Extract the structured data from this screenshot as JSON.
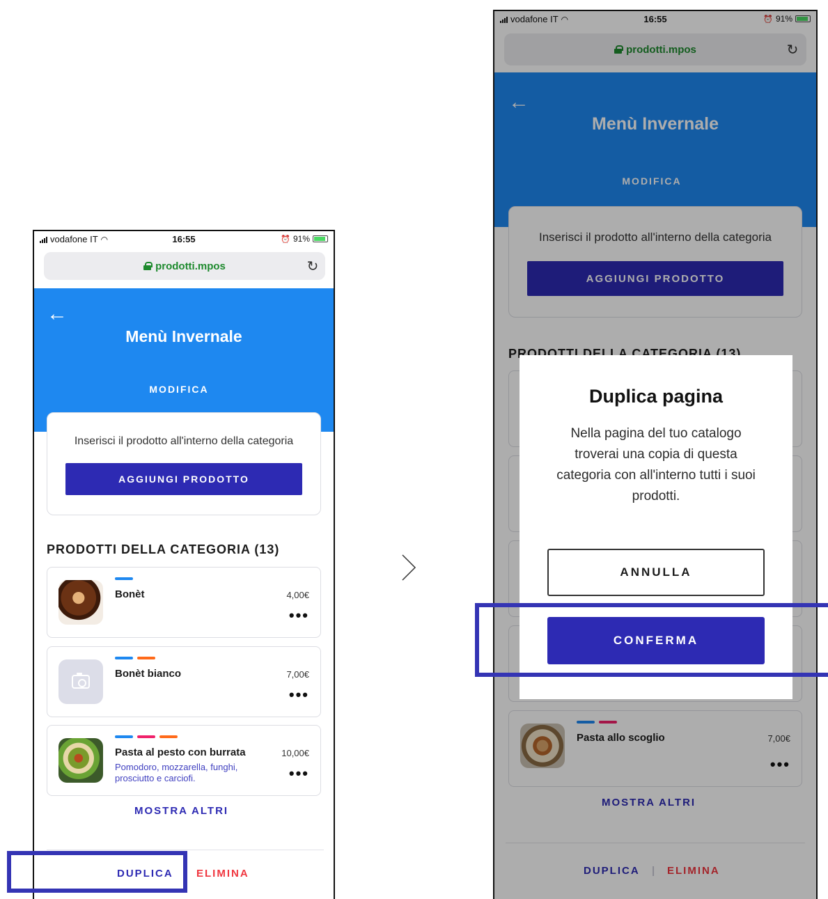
{
  "status_bar": {
    "carrier": "vodafone IT",
    "time": "16:55",
    "battery": "91%"
  },
  "browser": {
    "url": "prodotti.mpos"
  },
  "header": {
    "title": "Menù Invernale",
    "edit_label": "MODIFICA"
  },
  "add_card": {
    "hint": "Inserisci il prodotto all'interno della categoria",
    "button_label": "AGGIUNGI PRODOTTO"
  },
  "products_section": {
    "title": "PRODOTTI DELLA CATEGORIA (13)",
    "show_more_label": "MOSTRA ALTRI",
    "items": [
      {
        "name": "Bonèt",
        "price": "4,00€",
        "description": "",
        "tag_colors": [
          "#1e88f0"
        ],
        "thumb": "bonet-photo"
      },
      {
        "name": "Bonèt bianco",
        "price": "7,00€",
        "description": "",
        "tag_colors": [
          "#1e88f0",
          "#ff6a1a"
        ],
        "thumb": "camera-icon"
      },
      {
        "name": "Pasta al pesto con burrata",
        "price": "10,00€",
        "description": "Pomodoro, mozzarella, funghi, prosciutto e carciofi.",
        "tag_colors": [
          "#1e88f0",
          "#f0216a",
          "#ff6a1a"
        ],
        "thumb": "pasta-photo"
      },
      {
        "name": "Pasta allo scoglio",
        "price": "7,00€",
        "description": "",
        "tag_colors": [
          "#1e88f0",
          "#f0216a"
        ],
        "thumb": "scoglio-photo"
      }
    ]
  },
  "footer_actions": {
    "duplicate_label": "DUPLICA",
    "delete_label": "ELIMINA",
    "separator": "|"
  },
  "more_icon": "•••",
  "back_icon": "←",
  "reload_icon": "↻",
  "modal": {
    "title": "Duplica pagina",
    "body": "Nella pagina del tuo catalogo troverai una copia di questa categoria con all'interno tutti i suoi prodotti.",
    "cancel_label": "ANNULLA",
    "confirm_label": "CONFERMA"
  },
  "colors": {
    "header_blue": "#1e88f0",
    "primary_indigo": "#2d2ab3",
    "delete_red": "#f0363f",
    "highlight_border": "#3434b4"
  }
}
